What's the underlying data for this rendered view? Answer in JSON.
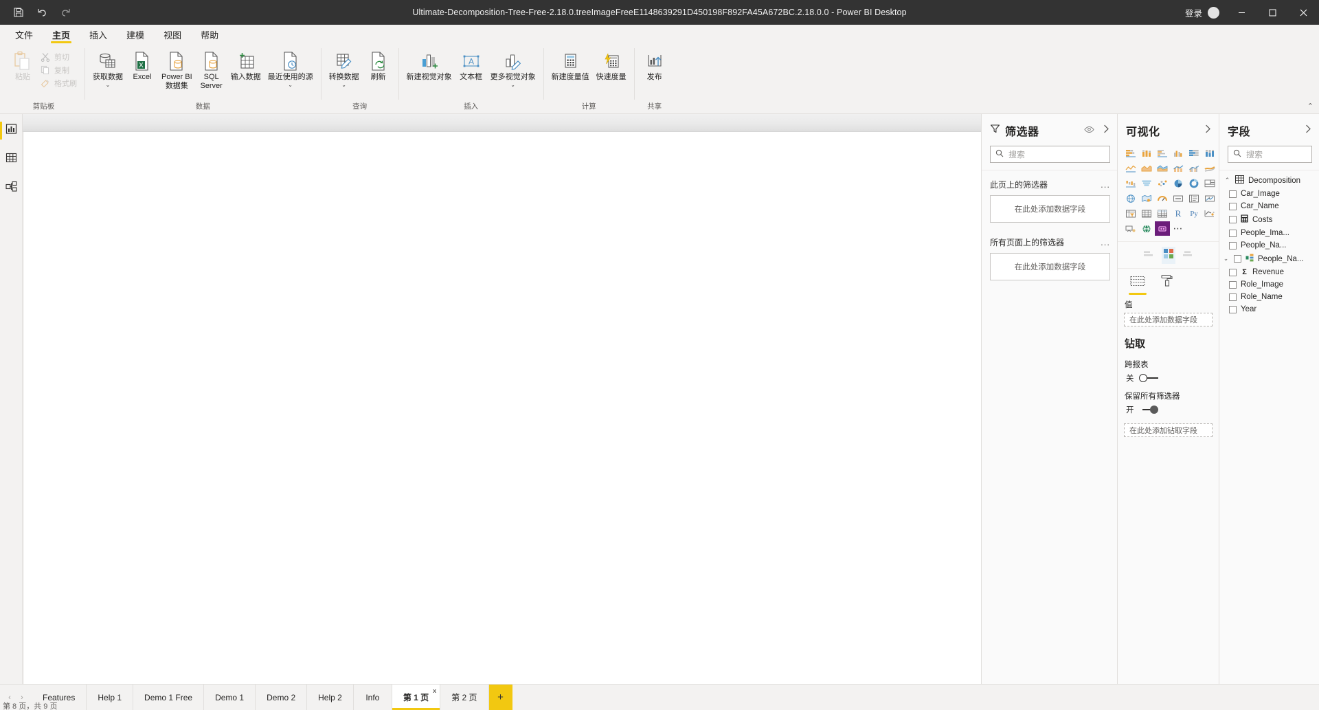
{
  "titlebar": {
    "document_title": "Ultimate-Decomposition-Tree-Free-2.18.0.treeImageFreeE1148639291D450198F892FA45A672BC.2.18.0.0 - Power BI Desktop",
    "quick_access": [
      {
        "name": "save-icon",
        "tooltip": "保存"
      },
      {
        "name": "undo-icon",
        "tooltip": "撤消"
      },
      {
        "name": "redo-icon",
        "tooltip": "恢复"
      }
    ],
    "signin_label": "登录",
    "window_buttons": {
      "minimize": "—",
      "maximize": "❐",
      "close": "✕"
    }
  },
  "ribbon_tabs": [
    {
      "label": "文件",
      "active": false
    },
    {
      "label": "主页",
      "active": true
    },
    {
      "label": "插入",
      "active": false
    },
    {
      "label": "建模",
      "active": false
    },
    {
      "label": "视图",
      "active": false
    },
    {
      "label": "帮助",
      "active": false
    }
  ],
  "ribbon": {
    "groups": [
      {
        "label": "剪贴板",
        "big_button": {
          "label": "粘贴",
          "icon": "paste-icon",
          "disabled": true
        },
        "small_buttons": [
          {
            "label": "剪切",
            "icon": "cut-icon",
            "disabled": true
          },
          {
            "label": "复制",
            "icon": "copy-icon",
            "disabled": true
          },
          {
            "label": "格式刷",
            "icon": "format-painter-icon",
            "disabled": true
          }
        ]
      },
      {
        "label": "数据",
        "buttons": [
          {
            "label": "获取数据",
            "icon": "get-data-icon",
            "caret": true
          },
          {
            "label": "Excel",
            "icon": "excel-icon",
            "caret": false
          },
          {
            "label": "Power BI\n数据集",
            "icon": "powerbi-dataset-icon",
            "caret": false
          },
          {
            "label": "SQL\nServer",
            "icon": "sql-server-icon",
            "caret": false
          },
          {
            "label": "输入数据",
            "icon": "enter-data-icon",
            "caret": false
          },
          {
            "label": "最近使用的源",
            "icon": "recent-sources-icon",
            "caret": true
          }
        ]
      },
      {
        "label": "查询",
        "buttons": [
          {
            "label": "转换数据",
            "icon": "transform-data-icon",
            "caret": true
          },
          {
            "label": "刷新",
            "icon": "refresh-icon",
            "caret": false
          }
        ]
      },
      {
        "label": "插入",
        "buttons": [
          {
            "label": "新建视觉对象",
            "icon": "new-visual-icon",
            "caret": false
          },
          {
            "label": "文本框",
            "icon": "text-box-icon",
            "caret": false
          },
          {
            "label": "更多视觉对象",
            "icon": "more-visuals-icon",
            "caret": true
          }
        ]
      },
      {
        "label": "计算",
        "buttons": [
          {
            "label": "新建度量值",
            "icon": "new-measure-icon",
            "caret": false
          },
          {
            "label": "快速度量",
            "icon": "quick-measure-icon",
            "caret": false
          }
        ]
      },
      {
        "label": "共享",
        "buttons": [
          {
            "label": "发布",
            "icon": "publish-icon",
            "caret": false
          }
        ]
      }
    ]
  },
  "left_rail": [
    {
      "name": "report-view",
      "icon": "report-chart-icon",
      "active": true
    },
    {
      "name": "data-view",
      "icon": "data-table-icon",
      "active": false
    },
    {
      "name": "model-view",
      "icon": "model-relationship-icon",
      "active": false
    }
  ],
  "filters_pane": {
    "title": "筛选器",
    "search_placeholder": "搜索",
    "sections": [
      {
        "label": "此页上的筛选器",
        "dropzone": "在此处添加数据字段",
        "menu": "..."
      },
      {
        "label": "所有页面上的筛选器",
        "dropzone": "在此处添加数据字段",
        "menu": "..."
      }
    ]
  },
  "visualizations_pane": {
    "title": "可视化",
    "icons": [
      "stacked-bar-chart",
      "stacked-column-chart",
      "clustered-bar-chart",
      "clustered-column-chart",
      "100-stacked-bar-chart",
      "100-stacked-column-chart",
      "line-chart",
      "area-chart",
      "stacked-area-chart",
      "line-stacked-column-chart",
      "line-clustered-column-chart",
      "ribbon-chart",
      "waterfall-chart",
      "funnel-chart",
      "scatter-chart",
      "pie-chart",
      "donut-chart",
      "treemap-chart",
      "map-visual",
      "filled-map-visual",
      "gauge-visual",
      "card-visual",
      "multi-row-card-visual",
      "kpi-visual",
      "slicer-visual",
      "table-visual",
      "matrix-visual",
      "r-script-visual",
      "python-visual",
      "key-influencers-visual",
      "decomposition-tree-visual",
      "qa-visual",
      "custom-purple-visual",
      "more-options"
    ],
    "format_tabs": [
      {
        "name": "fields-tab",
        "active": true
      },
      {
        "name": "format-tab",
        "active": false
      }
    ],
    "values_label": "值",
    "values_placeholder": "在此处添加数据字段",
    "drillthrough": {
      "title": "钻取",
      "cross_report_label": "跨报表",
      "cross_report_state": "关",
      "keep_filters_label": "保留所有筛选器",
      "keep_filters_state": "开",
      "dropzone": "在此处添加钻取字段"
    }
  },
  "fields_pane": {
    "title": "字段",
    "search_placeholder": "搜索",
    "table": {
      "name": "Decomposition",
      "expanded": true
    },
    "fields": [
      {
        "name": "Car_Image",
        "type": "text",
        "checked": false,
        "expandable": false
      },
      {
        "name": "Car_Name",
        "type": "text",
        "checked": false,
        "expandable": false
      },
      {
        "name": "Costs",
        "type": "calculator",
        "checked": false,
        "expandable": false
      },
      {
        "name": "People_Ima...",
        "type": "text",
        "checked": false,
        "expandable": false
      },
      {
        "name": "People_Na...",
        "type": "text",
        "checked": false,
        "expandable": false
      },
      {
        "name": "People_Na...",
        "type": "hierarchy",
        "checked": false,
        "expandable": true
      },
      {
        "name": "Revenue",
        "type": "sum",
        "checked": false,
        "expandable": false
      },
      {
        "name": "Role_Image",
        "type": "text",
        "checked": false,
        "expandable": false
      },
      {
        "name": "Role_Name",
        "type": "text",
        "checked": false,
        "expandable": false
      },
      {
        "name": "Year",
        "type": "text",
        "checked": false,
        "expandable": false
      }
    ]
  },
  "page_tabs": {
    "nav_prev": "‹",
    "nav_next": "›",
    "tabs": [
      {
        "label": "Features",
        "active": false
      },
      {
        "label": "Help 1",
        "active": false
      },
      {
        "label": "Demo 1 Free",
        "active": false
      },
      {
        "label": "Demo 1",
        "active": false
      },
      {
        "label": "Demo 2",
        "active": false
      },
      {
        "label": "Help 2",
        "active": false
      },
      {
        "label": "Info",
        "active": false
      },
      {
        "label": "第 1 页",
        "active": true,
        "close": "x"
      },
      {
        "label": "第 2 页",
        "active": false
      }
    ],
    "add_label": "+"
  },
  "statusbar": {
    "text": "第 8 页，共 9 页"
  },
  "colors": {
    "accent_yellow": "#f2c811",
    "titlebar_bg": "#333333",
    "ribbon_bg": "#f3f2f1",
    "custom_visual_purple": "#6b1d7a"
  }
}
